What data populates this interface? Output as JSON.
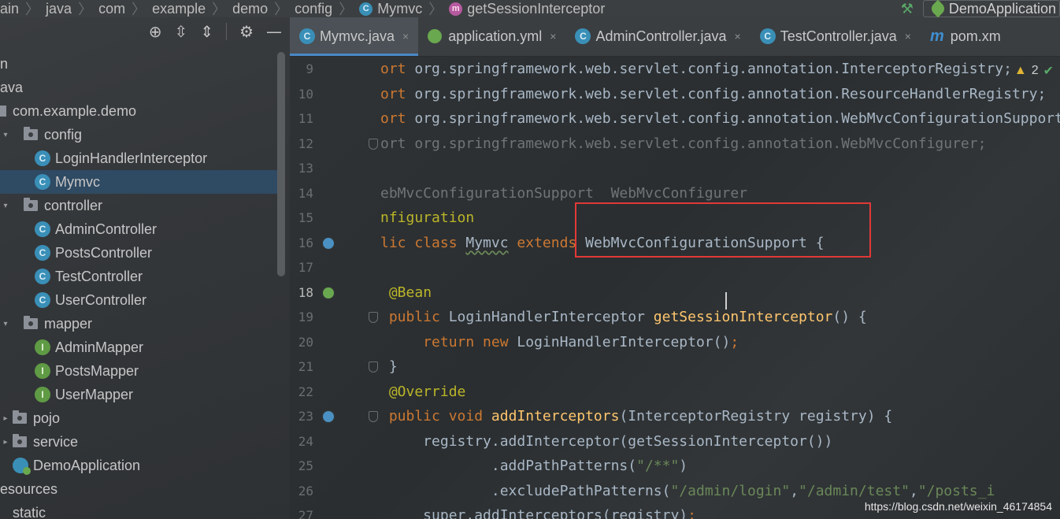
{
  "breadcrumb": {
    "items": [
      "ain",
      "java",
      "com",
      "example",
      "demo",
      "config",
      "Mymvc",
      "getSessionInterceptor"
    ],
    "class_badge": "C",
    "method_badge": "m"
  },
  "run_config": {
    "label": "DemoApplication"
  },
  "project_tree": {
    "items": [
      {
        "label": "n",
        "type": "folder-partial",
        "depth": 0
      },
      {
        "label": "ava",
        "type": "folder-partial",
        "depth": 0
      },
      {
        "label": "com.example.demo",
        "type": "package",
        "depth": 0
      },
      {
        "label": "config",
        "type": "folder",
        "depth": 1,
        "expanded": true
      },
      {
        "label": "LoginHandlerInterceptor",
        "type": "class",
        "depth": 2
      },
      {
        "label": "Mymvc",
        "type": "class",
        "depth": 2,
        "selected": true
      },
      {
        "label": "controller",
        "type": "folder",
        "depth": 1,
        "expanded": true
      },
      {
        "label": "AdminController",
        "type": "class",
        "depth": 2
      },
      {
        "label": "PostsController",
        "type": "class",
        "depth": 2
      },
      {
        "label": "TestController",
        "type": "class",
        "depth": 2
      },
      {
        "label": "UserController",
        "type": "class",
        "depth": 2
      },
      {
        "label": "mapper",
        "type": "folder",
        "depth": 1,
        "expanded": true
      },
      {
        "label": "AdminMapper",
        "type": "interface",
        "depth": 2
      },
      {
        "label": "PostsMapper",
        "type": "interface",
        "depth": 2
      },
      {
        "label": "UserMapper",
        "type": "interface",
        "depth": 2
      },
      {
        "label": "pojo",
        "type": "folder",
        "depth": 1,
        "expanded": false
      },
      {
        "label": "service",
        "type": "folder",
        "depth": 1,
        "expanded": false
      },
      {
        "label": "DemoApplication",
        "type": "app",
        "depth": 1
      },
      {
        "label": "esources",
        "type": "folder-partial",
        "depth": 0
      },
      {
        "label": "static",
        "type": "folder-partial",
        "depth": 1
      }
    ],
    "class_badge": "C",
    "interface_badge": "I"
  },
  "tabs": [
    {
      "label": "Mymvc.java",
      "active": true,
      "icon": "class-icon"
    },
    {
      "label": "application.yml",
      "active": false,
      "icon": "yml-icon"
    },
    {
      "label": "AdminController.java",
      "active": false,
      "icon": "class-icon"
    },
    {
      "label": "TestController.java",
      "active": false,
      "icon": "class-icon"
    },
    {
      "label": "pom.xm",
      "active": false,
      "icon": "maven-icon"
    }
  ],
  "tab_close_glyph": "×",
  "inspection": {
    "warnings": "2"
  },
  "code_lines": [
    {
      "num": "9",
      "segments": [
        [
          "kw",
          "ort "
        ],
        [
          "txt",
          "org.springframework.web.servlet.config.annotation.InterceptorRegistry;"
        ]
      ]
    },
    {
      "num": "10",
      "segments": [
        [
          "kw",
          "ort "
        ],
        [
          "txt",
          "org.springframework.web.servlet.config.annotation.ResourceHandlerRegistry;"
        ]
      ]
    },
    {
      "num": "11",
      "segments": [
        [
          "kw",
          "ort "
        ],
        [
          "txt",
          "org.springframework.web.servlet.config.annotation.WebMvcConfigurationSupport;"
        ]
      ]
    },
    {
      "num": "12",
      "segments": [
        [
          "faded",
          "ort org.springframework.web.servlet.config.annotation.WebMvcConfigurer;"
        ]
      ]
    },
    {
      "num": "13",
      "segments": []
    },
    {
      "num": "14",
      "segments": [
        [
          "faded",
          "ebMvcConfigurationSupport  WebMvcConfigurer"
        ]
      ]
    },
    {
      "num": "15",
      "segments": [
        [
          "ann",
          "nfiguration"
        ]
      ]
    },
    {
      "num": "16",
      "segments": [
        [
          "kw",
          "lic class "
        ],
        [
          "txt wavy",
          "Mymvc"
        ],
        [
          "kw",
          " extends "
        ],
        [
          "txt",
          "WebMvcConfigurationSupport {"
        ]
      ]
    },
    {
      "num": "17",
      "segments": []
    },
    {
      "num": "18",
      "segments": [
        [
          "txt",
          " "
        ],
        [
          "ann",
          "@Bean"
        ]
      ]
    },
    {
      "num": "19",
      "segments": [
        [
          "kw",
          " public "
        ],
        [
          "txt",
          "LoginHandlerInterceptor "
        ],
        [
          "fn",
          "getSessionInterceptor"
        ],
        [
          "txt",
          "() {"
        ]
      ]
    },
    {
      "num": "20",
      "segments": [
        [
          "kw",
          "     return new "
        ],
        [
          "txt",
          "LoginHandlerInterceptor()"
        ],
        [
          "kw",
          ";"
        ]
      ]
    },
    {
      "num": "21",
      "segments": [
        [
          "txt",
          " }"
        ]
      ]
    },
    {
      "num": "22",
      "segments": [
        [
          "ann",
          " @Override"
        ]
      ]
    },
    {
      "num": "23",
      "segments": [
        [
          "kw",
          " public void "
        ],
        [
          "fn",
          "addInterceptors"
        ],
        [
          "txt",
          "(InterceptorRegistry registry) {"
        ]
      ]
    },
    {
      "num": "24",
      "segments": [
        [
          "txt",
          "     registry.addInterceptor(getSessionInterceptor())"
        ]
      ]
    },
    {
      "num": "25",
      "segments": [
        [
          "txt",
          "             .addPathPatterns("
        ],
        [
          "str",
          "\"/**\""
        ],
        [
          "txt",
          ")"
        ]
      ]
    },
    {
      "num": "26",
      "segments": [
        [
          "txt",
          "             .excludePathPatterns("
        ],
        [
          "str",
          "\"/admin/login\""
        ],
        [
          "txt",
          ","
        ],
        [
          "str",
          "\"/admin/test\""
        ],
        [
          "txt",
          ","
        ],
        [
          "str",
          "\"/posts_i"
        ]
      ]
    },
    {
      "num": "27",
      "segments": [
        [
          "txt",
          "     super.addInterceptors(registry)"
        ],
        [
          "kw",
          ";"
        ]
      ]
    }
  ],
  "current_line": "18",
  "watermark": "https://blog.csdn.net/weixin_46174854",
  "colors": {
    "keyword": "#cc7832",
    "annotation": "#bbb529",
    "function": "#ffc66d",
    "string": "#6a8759",
    "text": "#a9b7c6",
    "highlight_box": "#e23838",
    "selection": "#2f4a63"
  }
}
